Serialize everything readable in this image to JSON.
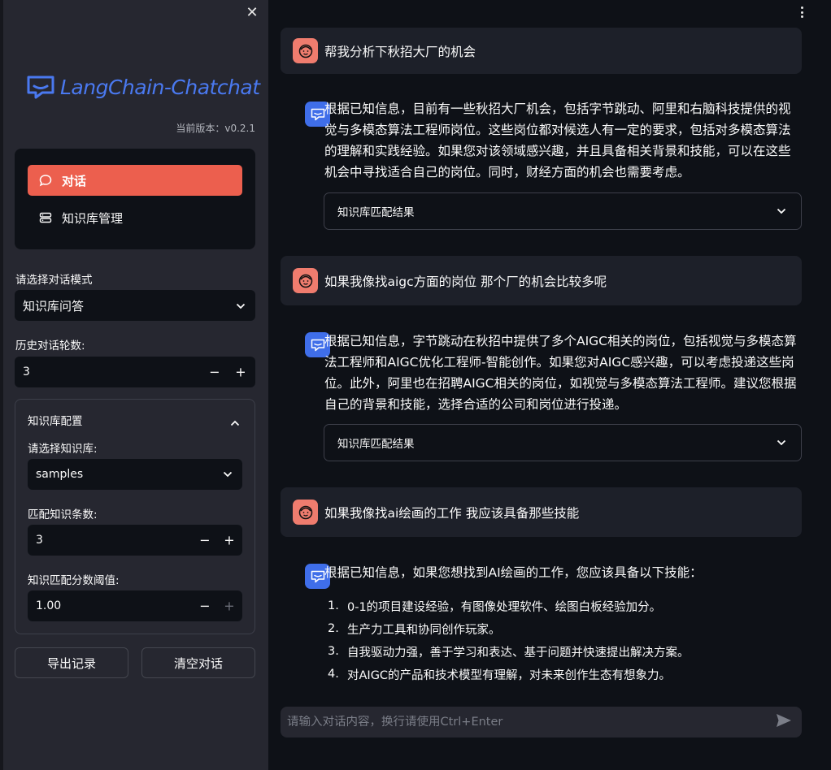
{
  "sidebar": {
    "logo_text": "LangChain-Chatchat",
    "version": "当前版本：v0.2.1",
    "nav": [
      {
        "label": "对话",
        "icon": "chat-bubble-icon"
      },
      {
        "label": "知识库管理",
        "icon": "database-icon"
      }
    ],
    "mode_label": "请选择对话模式",
    "mode_value": "知识库问答",
    "history_label": "历史对话轮数:",
    "history_value": "3",
    "kb_panel": {
      "title": "知识库配置",
      "kb_select_label": "请选择知识库:",
      "kb_select_value": "samples",
      "topk_label": "匹配知识条数:",
      "topk_value": "3",
      "threshold_label": "知识匹配分数阈值:",
      "threshold_value": "1.00"
    },
    "export_label": "导出记录",
    "clear_label": "清空对话",
    "accent": "#ec5f4e"
  },
  "chat": {
    "messages": [
      {
        "role": "user",
        "text": "帮我分析下秋招大厂的机会"
      },
      {
        "role": "assistant",
        "lines": [
          "根据已知信息，目前有一些秋招大厂机会，包括字节跳动、阿里和右脑科技提供的视",
          "觉与多模态算法工程师岗位。这些岗位都对候选人有一定的要求，包括对多模态算法",
          "的理解和实践经验。如果您对该领域感兴趣，并且具备相关背景和技能，可以在这些",
          "机会中寻找适合自己的岗位。同时，财经方面的机会也需要考虑。"
        ],
        "expander": "知识库匹配结果"
      },
      {
        "role": "user",
        "text": "如果我像找aigc方面的岗位 那个厂的机会比较多呢"
      },
      {
        "role": "assistant",
        "lines": [
          "根据已知信息，字节跳动在秋招中提供了多个AIGC相关的岗位，包括视觉与多模态算",
          "法工程师和AIGC优化工程师-智能创作。如果您对AIGC感兴趣，可以考虑投递这些岗",
          "位。此外，阿里也在招聘AIGC相关的岗位，如视觉与多模态算法工程师。建议您根据",
          "自己的背景和技能，选择合适的公司和岗位进行投递。"
        ],
        "expander": "知识库匹配结果"
      },
      {
        "role": "user",
        "text": "如果我像找ai绘画的工作 我应该具备那些技能"
      },
      {
        "role": "assistant",
        "intro": "根据已知信息，如果您想找到AI绘画的工作，您应该具备以下技能：",
        "items": [
          {
            "n": "1.",
            "text": "0-1的项目建设经验，有图像处理软件、绘图白板经验加分。"
          },
          {
            "n": "2.",
            "text": "生产力工具和协同创作玩家。"
          },
          {
            "n": "3.",
            "text": "自我驱动力强，善于学习和表达、基于问题并快速提出解决方案。"
          },
          {
            "n": "4.",
            "text": "对AIGC的产品和技术模型有理解，对未来创作生态有想象力。"
          }
        ]
      }
    ],
    "input_placeholder": "请输入对话内容，换行请使用Ctrl+Enter"
  }
}
